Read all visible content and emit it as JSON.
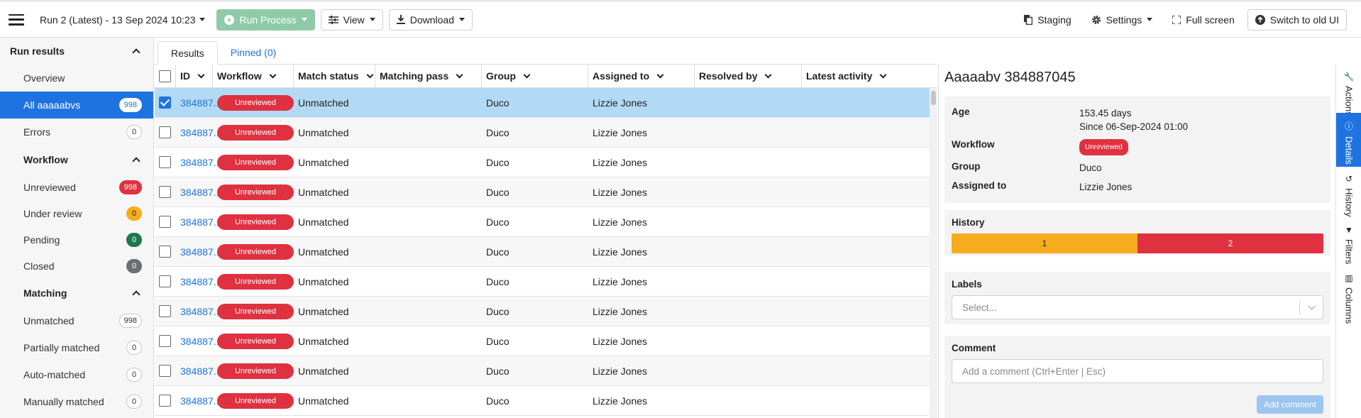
{
  "topbar": {
    "run_label": "Run 2 (Latest) - 13 Sep 2024 10:23",
    "run_process": "Run Process",
    "view": "View",
    "download": "Download",
    "staging": "Staging",
    "settings": "Settings",
    "fullscreen": "Full screen",
    "switch_old": "Switch to old UI"
  },
  "sidebar": {
    "run_results": "Run results",
    "overview": "Overview",
    "all_items": "All aaaaabvs",
    "all_count": "998",
    "errors": "Errors",
    "errors_count": "0",
    "workflow": "Workflow",
    "unreviewed": "Unreviewed",
    "unreviewed_count": "998",
    "under_review": "Under review",
    "under_review_count": "0",
    "pending": "Pending",
    "pending_count": "0",
    "closed": "Closed",
    "closed_count": "0",
    "matching": "Matching",
    "unmatched": "Unmatched",
    "unmatched_count": "998",
    "partially": "Partially matched",
    "partially_count": "0",
    "auto": "Auto-matched",
    "auto_count": "0",
    "manual": "Manually matched",
    "manual_count": "0"
  },
  "tabs": {
    "results": "Results",
    "pinned": "Pinned (0)"
  },
  "grid": {
    "columns": [
      "ID",
      "Workflow",
      "Match status",
      "Matching pass",
      "Group",
      "Assigned to",
      "Resolved by",
      "Latest activity"
    ],
    "rows": [
      {
        "id": "384887...",
        "workflow": "Unreviewed",
        "match_status": "Unmatched",
        "matching_pass": "",
        "group": "Duco",
        "assigned_to": "Lizzie Jones",
        "resolved_by": "",
        "latest_activity": ""
      },
      {
        "id": "384887...",
        "workflow": "Unreviewed",
        "match_status": "Unmatched",
        "matching_pass": "",
        "group": "Duco",
        "assigned_to": "Lizzie Jones",
        "resolved_by": "",
        "latest_activity": ""
      },
      {
        "id": "384887...",
        "workflow": "Unreviewed",
        "match_status": "Unmatched",
        "matching_pass": "",
        "group": "Duco",
        "assigned_to": "Lizzie Jones",
        "resolved_by": "",
        "latest_activity": ""
      },
      {
        "id": "384887...",
        "workflow": "Unreviewed",
        "match_status": "Unmatched",
        "matching_pass": "",
        "group": "Duco",
        "assigned_to": "Lizzie Jones",
        "resolved_by": "",
        "latest_activity": ""
      },
      {
        "id": "384887...",
        "workflow": "Unreviewed",
        "match_status": "Unmatched",
        "matching_pass": "",
        "group": "Duco",
        "assigned_to": "Lizzie Jones",
        "resolved_by": "",
        "latest_activity": ""
      },
      {
        "id": "384887...",
        "workflow": "Unreviewed",
        "match_status": "Unmatched",
        "matching_pass": "",
        "group": "Duco",
        "assigned_to": "Lizzie Jones",
        "resolved_by": "",
        "latest_activity": ""
      },
      {
        "id": "384887...",
        "workflow": "Unreviewed",
        "match_status": "Unmatched",
        "matching_pass": "",
        "group": "Duco",
        "assigned_to": "Lizzie Jones",
        "resolved_by": "",
        "latest_activity": ""
      },
      {
        "id": "384887...",
        "workflow": "Unreviewed",
        "match_status": "Unmatched",
        "matching_pass": "",
        "group": "Duco",
        "assigned_to": "Lizzie Jones",
        "resolved_by": "",
        "latest_activity": ""
      },
      {
        "id": "384887...",
        "workflow": "Unreviewed",
        "match_status": "Unmatched",
        "matching_pass": "",
        "group": "Duco",
        "assigned_to": "Lizzie Jones",
        "resolved_by": "",
        "latest_activity": ""
      },
      {
        "id": "384887...",
        "workflow": "Unreviewed",
        "match_status": "Unmatched",
        "matching_pass": "",
        "group": "Duco",
        "assigned_to": "Lizzie Jones",
        "resolved_by": "",
        "latest_activity": ""
      },
      {
        "id": "384887...",
        "workflow": "Unreviewed",
        "match_status": "Unmatched",
        "matching_pass": "",
        "group": "Duco",
        "assigned_to": "Lizzie Jones",
        "resolved_by": "",
        "latest_activity": ""
      }
    ]
  },
  "details": {
    "title": "Aaaaabv 384887045",
    "age_label": "Age",
    "age_value": "153.45 days",
    "age_since": "Since 06-Sep-2024 01:00",
    "workflow_label": "Workflow",
    "workflow_value": "Unreviewed",
    "group_label": "Group",
    "group_value": "Duco",
    "assigned_label": "Assigned to",
    "assigned_value": "Lizzie Jones",
    "history_label": "History",
    "history_seg1": "1",
    "history_seg2": "2",
    "labels_label": "Labels",
    "labels_placeholder": "Select...",
    "comment_label": "Comment",
    "comment_placeholder": "Add a comment (Ctrl+Enter | Esc)",
    "add_comment": "Add comment"
  },
  "rail": {
    "actions": "Actions",
    "details": "Details",
    "history": "History",
    "filters": "Filters",
    "columns": "Columns"
  },
  "colors": {
    "accent": "#1f73e0",
    "danger": "#e03140",
    "warning": "#f5ad1d",
    "success": "#1c7a4a"
  }
}
